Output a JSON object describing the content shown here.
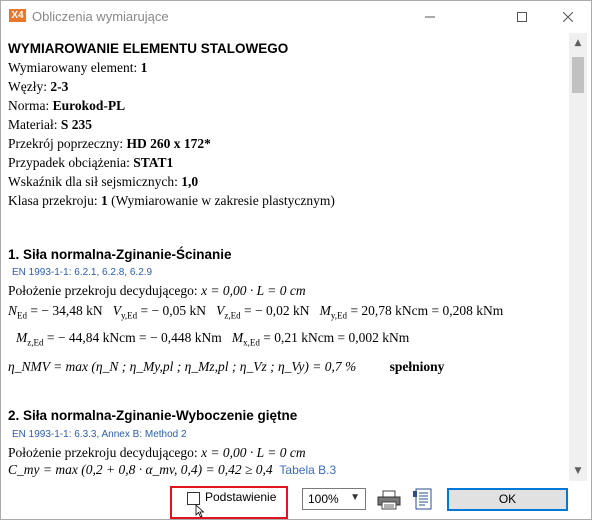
{
  "window": {
    "title": "Obliczenia wymiarujące",
    "app_icon": "X4"
  },
  "content": {
    "heading": "WYMIAROWANIE ELEMENTU STALOWEGO",
    "rows": [
      {
        "label": "Wymiarowany element: ",
        "value": "1"
      },
      {
        "label": "Węzły: ",
        "value": "2-3"
      },
      {
        "label": "Norma: ",
        "value": "Eurokod-PL"
      },
      {
        "label": "Materiał: ",
        "value": "S 235"
      },
      {
        "label": "Przekrój poprzeczny: ",
        "value": "HD 260 x 172*"
      },
      {
        "label": "Przypadek obciążenia: ",
        "value": "STAT1"
      },
      {
        "label": "Wskaźnik dla sił sejsmicznych: ",
        "value": "1,0"
      }
    ],
    "class_row": {
      "label": "Klasa przekroju: ",
      "value": "1",
      "note": " (Wymiarowanie w zakresie plastycznym)"
    },
    "section1": {
      "title": "1. Siła normalna-Zginanie-Ścinanie",
      "ref": "EN 1993-1-1: 6.2.1, 6.2.8, 6.2.9",
      "position": "Położenie przekroju decydującego: ",
      "position_formula": "x = 0,00 · L = 0 cm",
      "forces1": [
        {
          "sym": "N",
          "sub": "Ed",
          "val": "= − 34,48 kN"
        },
        {
          "sym": "V",
          "sub": "y,Ed",
          "val": "= − 0,05 kN"
        },
        {
          "sym": "V",
          "sub": "z,Ed",
          "val": "= − 0,02 kN"
        },
        {
          "sym": "M",
          "sub": "y,Ed",
          "val": "= 20,78 kNcm = 0,208 kNm"
        }
      ],
      "forces2": [
        {
          "sym": "M",
          "sub": "z,Ed",
          "val": "= − 44,84 kNcm = − 0,448 kNm"
        },
        {
          "sym": "M",
          "sub": "x,Ed",
          "val": "= 0,21 kNcm = 0,002 kNm"
        }
      ],
      "eta_formula": "η_NMV = max (η_N ; η_My,pl ; η_Mz,pl ; η_Vz ; η_Vy) = 0,7 %",
      "status": "spełniony"
    },
    "section2": {
      "title": "2. Siła normalna-Zginanie-Wyboczenie giętne",
      "ref": "EN 1993-1-1: 6.3.3, Annex B: Method 2",
      "position": "Położenie przekroju decydującego: ",
      "position_formula": "x = 0,00 · L = 0 cm",
      "cmy_formula": "C_my = max (0,2 + 0,8 · α_mv, 0,4) = 0,42 ≥ 0,4",
      "table_ref": "Tabela B.3"
    }
  },
  "footer": {
    "checkbox_label": "Podstawienie",
    "checkbox_checked": false,
    "zoom_value": "100%",
    "ok_label": "OK"
  },
  "colors": {
    "highlight": "#e0141e",
    "link": "#3a6cc0",
    "accent": "#0078d7"
  }
}
